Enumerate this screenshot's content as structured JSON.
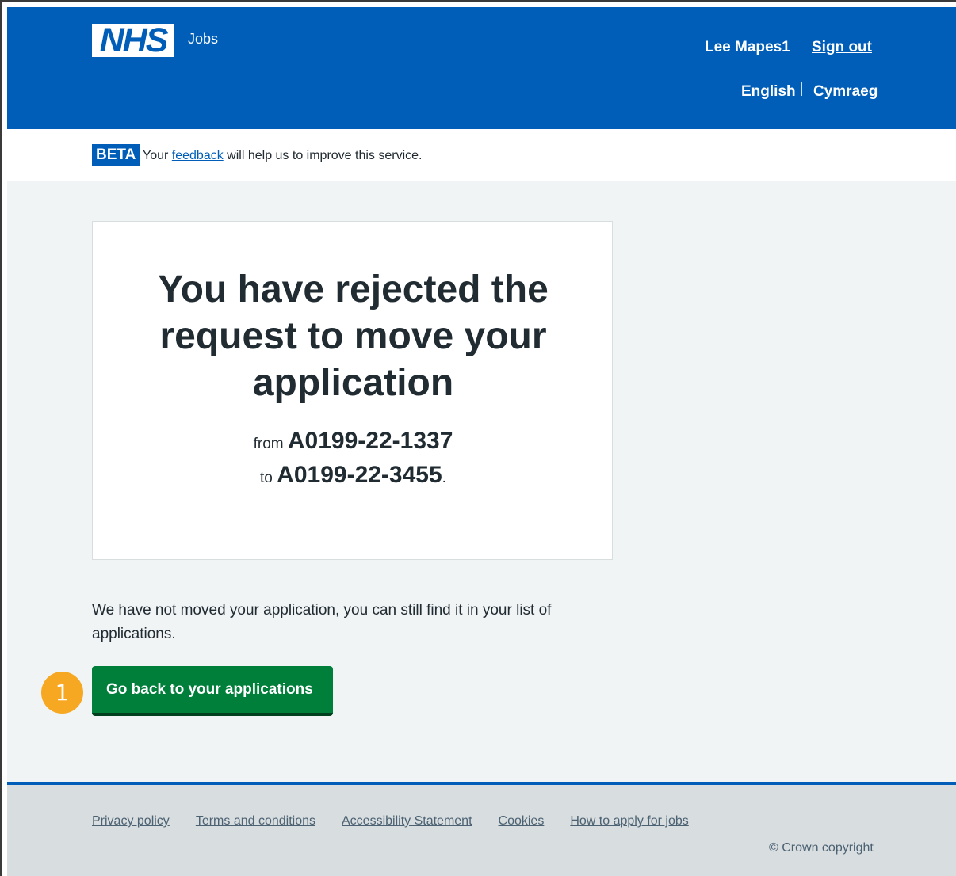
{
  "header": {
    "logo_text": "NHS",
    "service_name": "Jobs",
    "account_name": "Lee Mapes1",
    "sign_out_label": "Sign out",
    "language_current": "English",
    "language_alt": "Cymraeg",
    "background_color": "#005eb8"
  },
  "beta_banner": {
    "tag": "BETA",
    "text_before": "Your",
    "link_text": "feedback",
    "text_after": "will help us to improve this service."
  },
  "panel": {
    "title": "You have rejected the request to move your application",
    "from_label": "from",
    "from_ref": "A0199-22-1337",
    "to_label": "to",
    "to_ref": "A0199-22-3455",
    "period": "."
  },
  "body": {
    "message": "We have not moved your application, you can still find it in your list of applications."
  },
  "primary_button": {
    "label": "Go back to your applications",
    "color": "#007f3b"
  },
  "step_marker": {
    "number": "1",
    "color": "#f7a823"
  },
  "footer": {
    "links": [
      "Privacy policy",
      "Terms and conditions",
      "Accessibility Statement",
      "Cookies",
      "How to apply for jobs"
    ],
    "copyright": "© Crown copyright"
  }
}
